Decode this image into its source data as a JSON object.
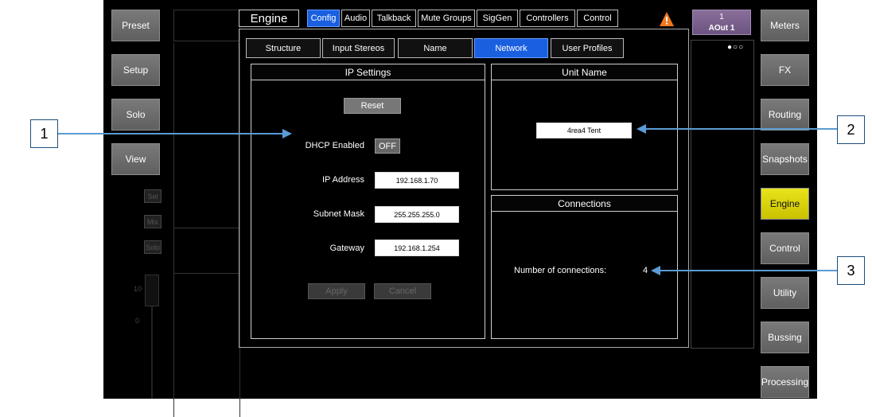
{
  "left_sidebar": [
    "Preset",
    "Setup",
    "Solo",
    "View"
  ],
  "left_small_buttons": [
    "Sel",
    "Mix",
    "Solo"
  ],
  "fader_scale": [
    "10",
    "0"
  ],
  "top_tabs": [
    {
      "label": "Engine",
      "active": false
    },
    {
      "label": "Config",
      "active": true
    },
    {
      "label": "Audio",
      "active": false
    },
    {
      "label": "Talkback",
      "active": false
    },
    {
      "label": "Mute Groups",
      "active": false
    },
    {
      "label": "SigGen",
      "active": false
    },
    {
      "label": "Controllers",
      "active": false
    },
    {
      "label": "Control",
      "active": false
    }
  ],
  "output_badge": {
    "number": "1",
    "label": "AOut 1"
  },
  "sub_tabs": [
    {
      "label": "Structure",
      "active": false
    },
    {
      "label": "Input Stereos",
      "active": false
    },
    {
      "label": "Name",
      "active": false
    },
    {
      "label": "Network",
      "active": true
    },
    {
      "label": "User Profiles",
      "active": false
    }
  ],
  "ip_settings": {
    "title": "IP Settings",
    "reset": "Reset",
    "dhcp_label": "DHCP Enabled",
    "dhcp_value": "OFF",
    "ip_label": "IP Address",
    "ip_value": "192.168.1.70",
    "mask_label": "Subnet Mask",
    "mask_value": "255.255.255.0",
    "gateway_label": "Gateway",
    "gateway_value": "192.168.1.254",
    "apply": "Apply",
    "cancel": "Cancel"
  },
  "unit_name": {
    "title": "Unit Name",
    "value": "4rea4 Tent"
  },
  "connections": {
    "title": "Connections",
    "label": "Number of connections:",
    "value": "4"
  },
  "right_sidebar": [
    {
      "label": "Meters",
      "active": false
    },
    {
      "label": "FX",
      "active": false
    },
    {
      "label": "Routing",
      "active": false
    },
    {
      "label": "Snapshots",
      "active": false
    },
    {
      "label": "Engine",
      "active": true
    },
    {
      "label": "Control",
      "active": false
    },
    {
      "label": "Utility",
      "active": false
    },
    {
      "label": "Bussing",
      "active": false
    },
    {
      "label": "Processing",
      "active": false
    }
  ],
  "callouts": [
    "1",
    "2",
    "3"
  ],
  "colors": {
    "accent_blue": "#1a5fe0",
    "engine_yellow": "#e0d800",
    "arrow": "#5b9bd5",
    "warning": "#f07820"
  }
}
